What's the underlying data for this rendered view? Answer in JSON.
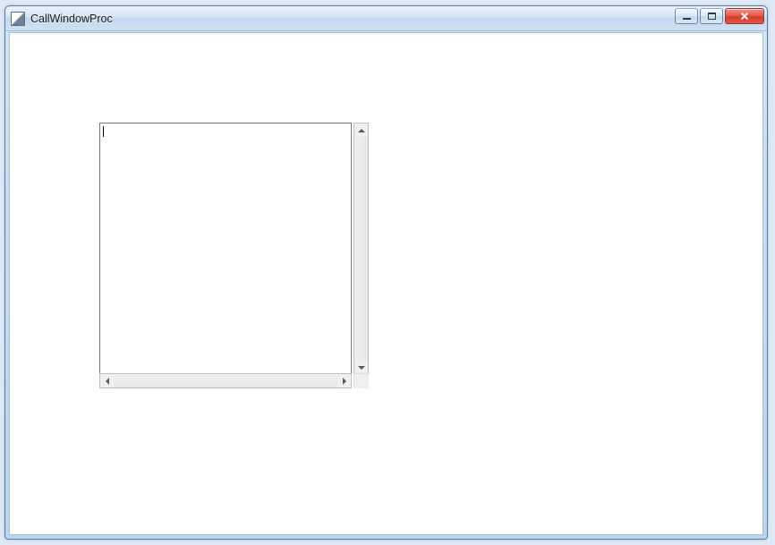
{
  "window": {
    "title": "CallWindowProc"
  },
  "editor": {
    "value": ""
  }
}
